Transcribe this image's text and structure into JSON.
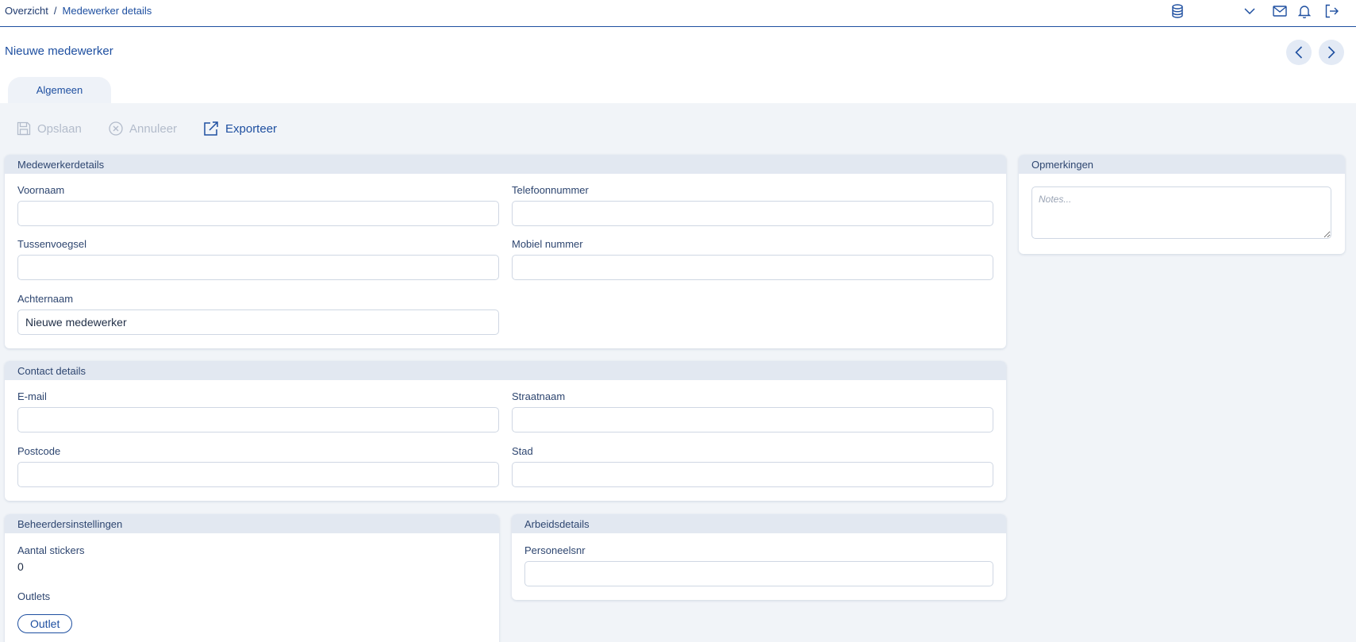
{
  "breadcrumb": {
    "items": [
      "Overzicht",
      "Medewerker details"
    ],
    "separator": "/"
  },
  "header": {
    "title": "Nieuwe medewerker"
  },
  "tabs": [
    {
      "label": "Algemeen",
      "active": true
    }
  ],
  "toolbar": {
    "save_label": "Opslaan",
    "cancel_label": "Annuleer",
    "export_label": "Exporteer"
  },
  "employee_details": {
    "title": "Medewerkerdetails",
    "first_name": {
      "label": "Voornaam",
      "value": ""
    },
    "phone": {
      "label": "Telefoonnummer",
      "value": ""
    },
    "infix": {
      "label": "Tussenvoegsel",
      "value": ""
    },
    "mobile": {
      "label": "Mobiel nummer",
      "value": ""
    },
    "last_name": {
      "label": "Achternaam",
      "value": "Nieuwe medewerker"
    }
  },
  "contact_details": {
    "title": "Contact details",
    "email": {
      "label": "E-mail",
      "value": ""
    },
    "street": {
      "label": "Straatnaam",
      "value": ""
    },
    "postcode": {
      "label": "Postcode",
      "value": ""
    },
    "city": {
      "label": "Stad",
      "value": ""
    }
  },
  "admin_settings": {
    "title": "Beheerdersinstellingen",
    "stickers_label": "Aantal stickers",
    "stickers_value": "0",
    "outlets_label": "Outlets",
    "outlet_pill": "Outlet"
  },
  "work_details": {
    "title": "Arbeidsdetails",
    "staff_number": {
      "label": "Personeelsnr",
      "value": ""
    }
  },
  "remarks": {
    "title": "Opmerkingen",
    "placeholder": "Notes..."
  },
  "icons": [
    "database-icon",
    "chevron-down-icon",
    "mail-icon",
    "bell-icon",
    "logout-icon",
    "chevron-left-icon",
    "chevron-right-icon",
    "save-icon",
    "cancel-icon",
    "export-icon"
  ],
  "colors": {
    "accent": "#1e4fa0",
    "panel_header": "#e2e8f1",
    "background": "#f1f4f8",
    "disabled": "#b3bccb"
  }
}
